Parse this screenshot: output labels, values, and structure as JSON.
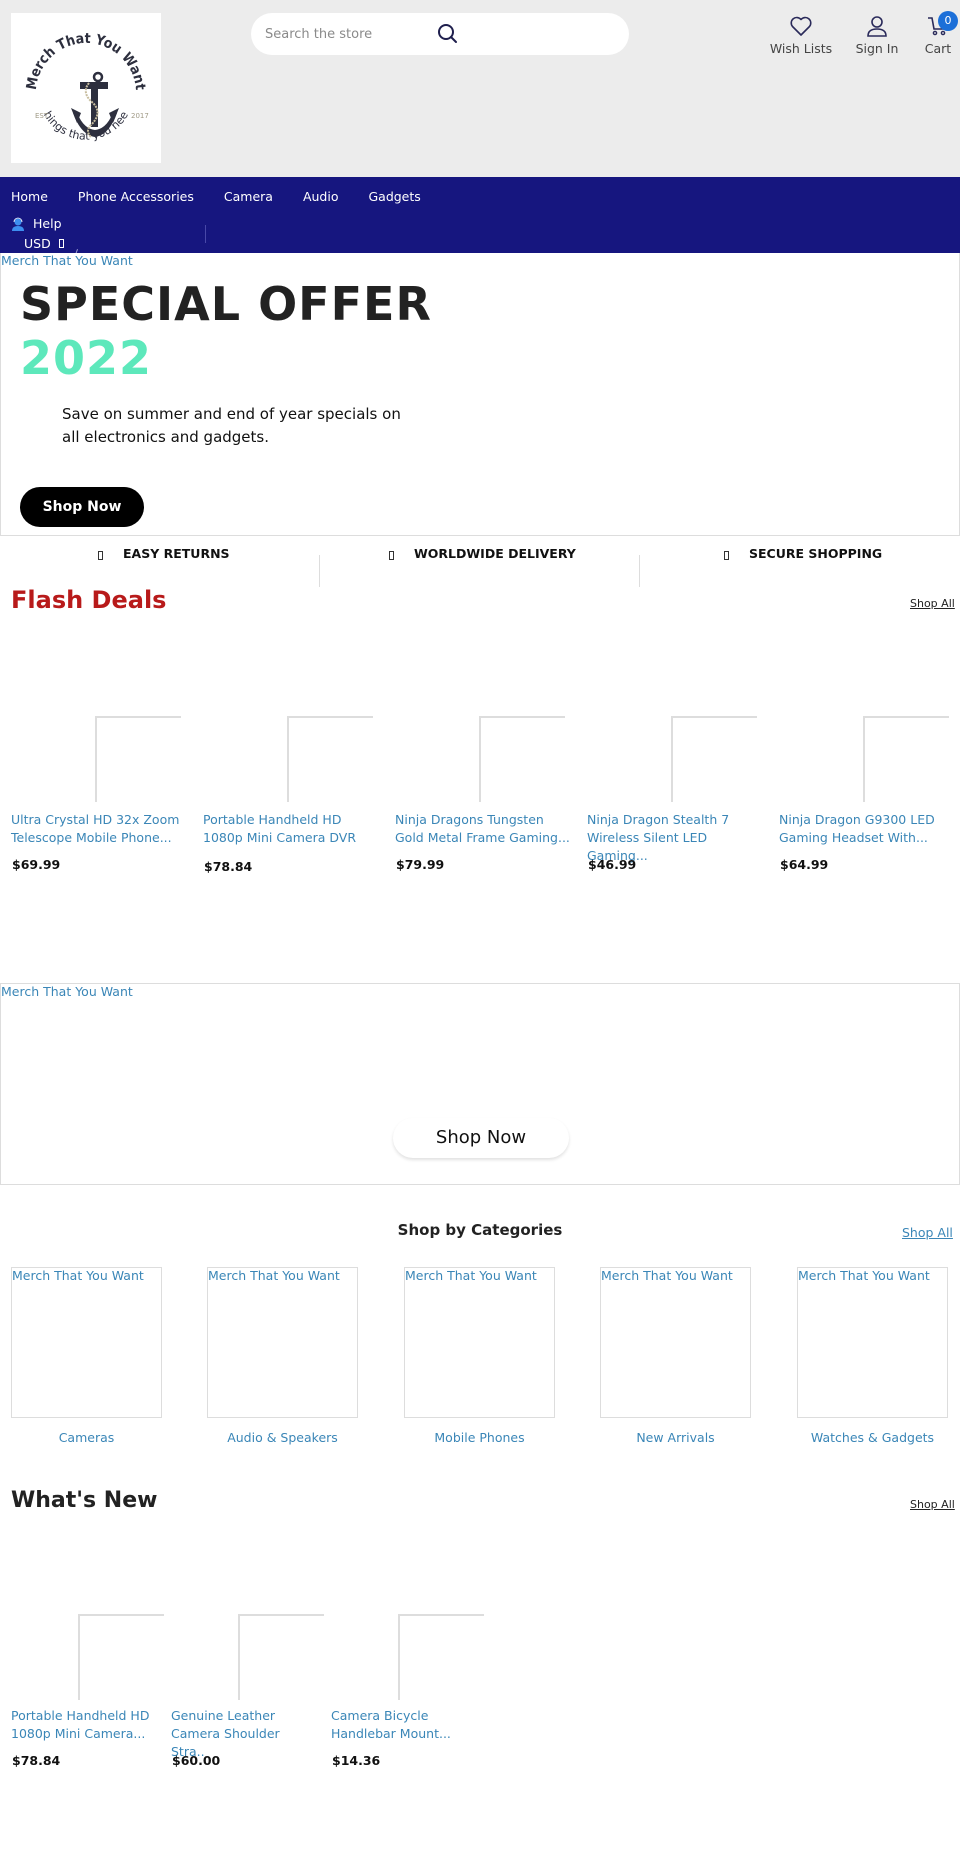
{
  "header": {
    "logo": {
      "top_text": "Merch That You Want",
      "bottom_text": "Things that you need",
      "est_label": "EST.",
      "est_year": "2017"
    },
    "search": {
      "placeholder": "Search the store",
      "value": ""
    },
    "actions": {
      "wishlist": "Wish Lists",
      "signin": "Sign In",
      "cart": "Cart",
      "cart_count": "0"
    }
  },
  "nav": {
    "links": [
      "Home",
      "Phone Accessories",
      "Camera",
      "Audio",
      "Gadgets"
    ],
    "help": "Help",
    "currency": "USD"
  },
  "hero": {
    "alt_text": "Merch That You Want",
    "title": "SPECIAL OFFER",
    "year": "2022",
    "description": "Save on summer and end of year specials on all electronics and gadgets.",
    "button": "Shop Now"
  },
  "features": [
    "EASY RETURNS",
    "WORLDWIDE DELIVERY",
    "SECURE SHOPPING"
  ],
  "flash_deals": {
    "title": "Flash Deals",
    "shop_all": "Shop All",
    "products": [
      {
        "name": "Ultra Crystal HD 32x Zoom Telescope Mobile Phone...",
        "price": "$69.99"
      },
      {
        "name": "Portable Handheld HD 1080p Mini Camera DVR",
        "price": "$78.84"
      },
      {
        "name": "Ninja Dragons Tungsten Gold Metal Frame Gaming...",
        "price": "$79.99"
      },
      {
        "name": "Ninja Dragon Stealth 7 Wireless Silent LED Gaming...",
        "price": "$46.99"
      },
      {
        "name": "Ninja Dragon G9300 LED Gaming Headset With...",
        "price": "$64.99"
      }
    ]
  },
  "banner2": {
    "alt_text": "Merch That You Want",
    "button": "Shop Now"
  },
  "categories": {
    "title": "Shop by Categories",
    "shop_all": "Shop All",
    "items": [
      {
        "alt_text": "Merch That You Want",
        "label": "Cameras"
      },
      {
        "alt_text": "Merch That You Want",
        "label": "Audio & Speakers"
      },
      {
        "alt_text": "Merch That You Want",
        "label": "Mobile Phones"
      },
      {
        "alt_text": "Merch That You Want",
        "label": "New Arrivals"
      },
      {
        "alt_text": "Merch That You Want",
        "label": "Watches & Gadgets"
      }
    ]
  },
  "whats_new": {
    "title": "What's New",
    "shop_all": "Shop All",
    "products": [
      {
        "name": "Portable Handheld HD 1080p Mini Camera...",
        "price": "$78.84"
      },
      {
        "name": "Genuine Leather Camera Shoulder Stra..",
        "price": "$60.00"
      },
      {
        "name": "Camera Bicycle Handlebar Mount...",
        "price": "$14.36"
      }
    ]
  },
  "colors": {
    "nav_bg": "#16167f",
    "header_bg": "#ececec",
    "accent_teal": "#5de8bb",
    "flash_red": "#b81a1a",
    "link_blue": "#3a86b7",
    "cart_badge": "#1c6fd8"
  }
}
